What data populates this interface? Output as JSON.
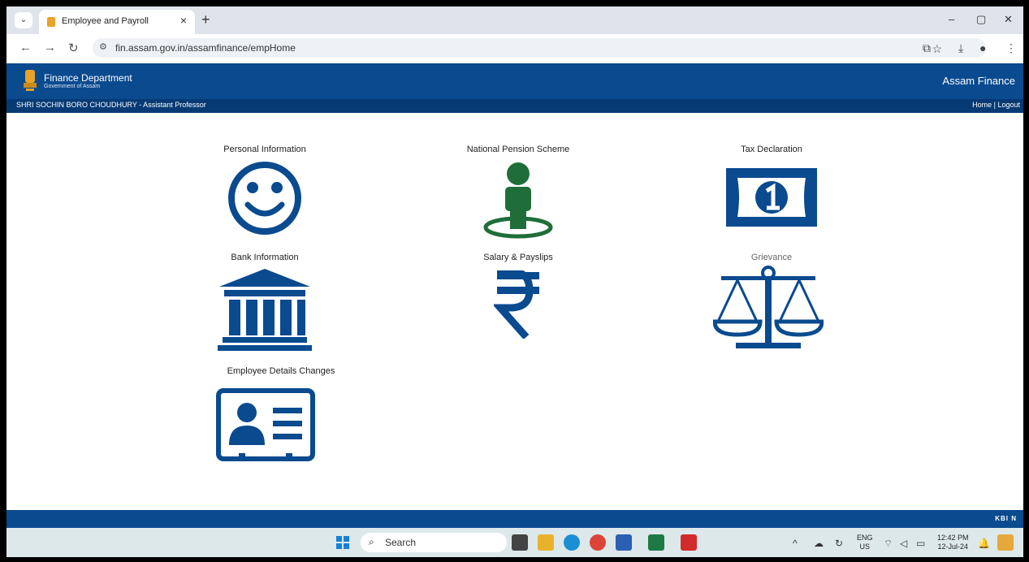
{
  "browser": {
    "tab_title": "Employee and Payroll",
    "tab_close": "×",
    "new_tab": "+",
    "url": "fin.assam.gov.in/assamfinance/empHome",
    "controls": {
      "minimize": "–",
      "restore": "▢",
      "close": "✕"
    }
  },
  "header": {
    "dept_title": "Finance Department",
    "dept_sub": "Government of Assam",
    "brand": "Assam Finance",
    "user": "SHRI SOCHIN BORO CHOUDHURY - Assistant Professor",
    "links": {
      "home": "Home",
      "sep": "|",
      "logout": "Logout"
    }
  },
  "tiles": [
    {
      "label": "Personal Information",
      "icon": "smiley-icon"
    },
    {
      "label": "National Pension Scheme",
      "icon": "person-location-icon"
    },
    {
      "label": "Tax Declaration",
      "icon": "banknote-icon"
    },
    {
      "label": "Bank Information",
      "icon": "bank-icon"
    },
    {
      "label": "Salary & Payslips",
      "icon": "rupee-icon"
    },
    {
      "label": "Grievance",
      "icon": "scales-icon"
    },
    {
      "label": "Employee Details Changes",
      "icon": "id-card-icon"
    }
  ],
  "footer": {
    "logo": "KBI N"
  },
  "taskbar": {
    "search": "Search",
    "lang_top": "ENG",
    "lang_bottom": "US",
    "time": "12:42 PM",
    "date": "12-Jul-24"
  },
  "colors": {
    "brand_blue": "#0a4a8f",
    "icon_blue": "#0a4a8f",
    "pension_green": "#1f6e3a"
  }
}
